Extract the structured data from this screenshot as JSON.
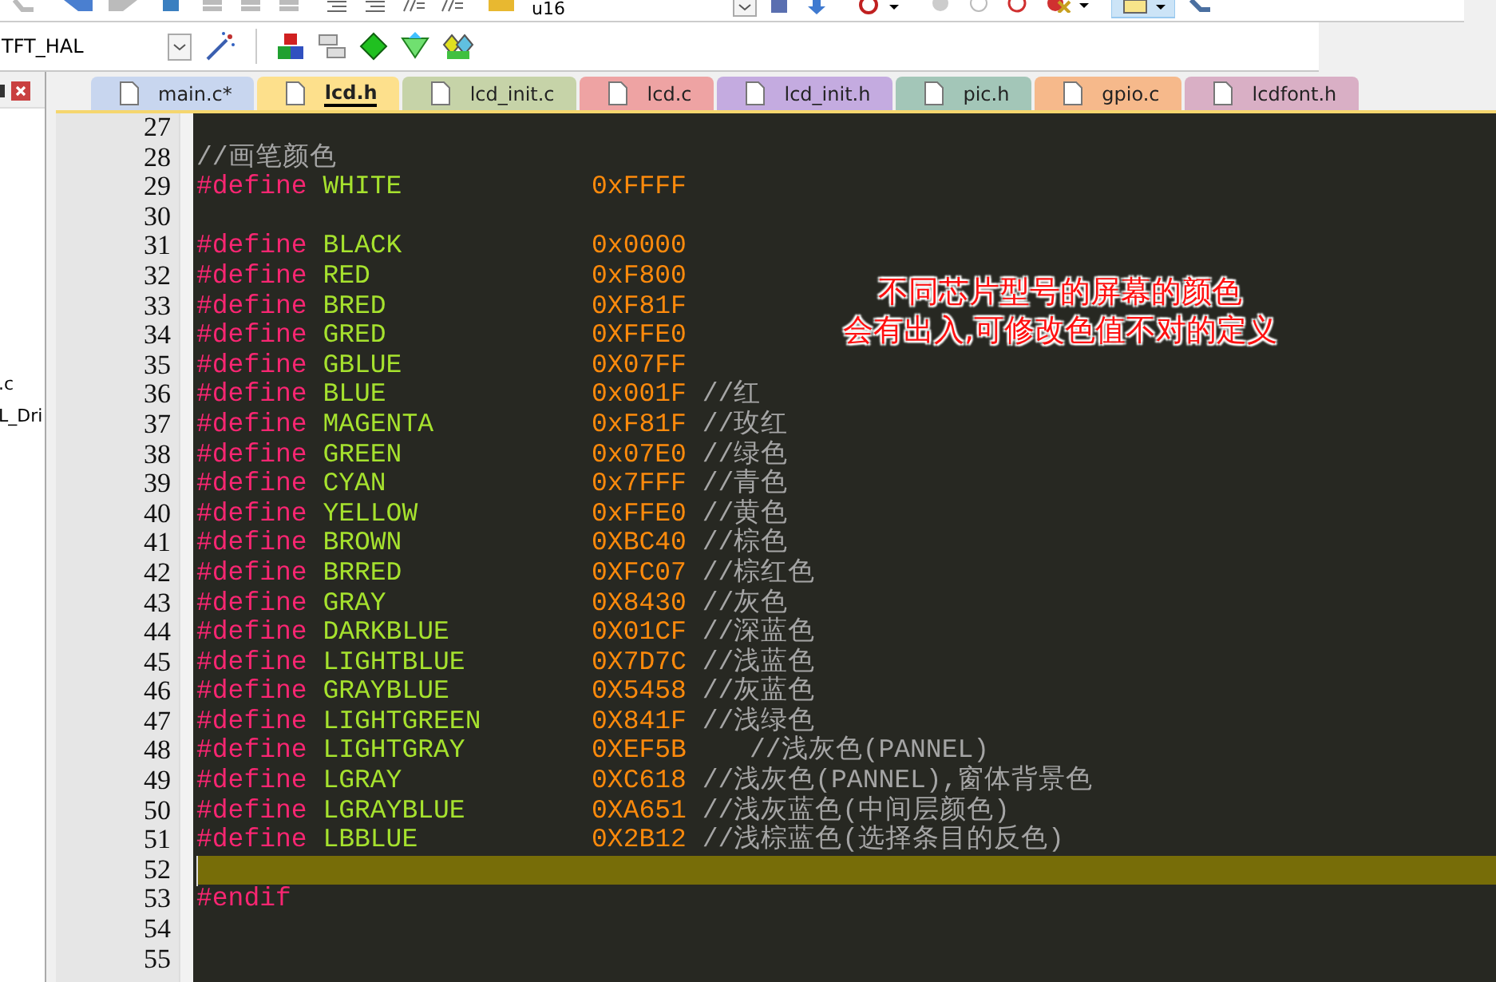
{
  "toolbar_top": {
    "target": "u16"
  },
  "toolbar": {
    "project": "TFT_HAL"
  },
  "project_panel": {
    "items": [
      ".c",
      "L_Dri"
    ]
  },
  "tabs": [
    {
      "label": "main.c*",
      "color": "#c8d6ef",
      "selected": false
    },
    {
      "label": "lcd.h",
      "color": "#fde08c",
      "selected": true
    },
    {
      "label": "lcd_init.c",
      "color": "#c6d3a8",
      "selected": false
    },
    {
      "label": "lcd.c",
      "color": "#eea3a3",
      "selected": false
    },
    {
      "label": "lcd_init.h",
      "color": "#c4abe0",
      "selected": false
    },
    {
      "label": "pic.h",
      "color": "#a3c6b8",
      "selected": false
    },
    {
      "label": "gpio.c",
      "color": "#f6b98b",
      "selected": false
    },
    {
      "label": "lcdfont.h",
      "color": "#d9afc5",
      "selected": false
    }
  ],
  "lines": [
    {
      "number": "27",
      "kind": "blank",
      "current": false
    },
    {
      "number": "28",
      "kind": "comment",
      "text": "//画笔颜色",
      "current": false
    },
    {
      "number": "29",
      "kind": "define",
      "keyword": "#define",
      "name": "WHITE",
      "value": "0xFFFF",
      "current": false
    },
    {
      "number": "30",
      "kind": "blank",
      "current": false
    },
    {
      "number": "31",
      "kind": "define",
      "keyword": "#define",
      "name": "BLACK",
      "value": "0x0000",
      "current": false
    },
    {
      "number": "32",
      "kind": "define",
      "keyword": "#define",
      "name": "RED",
      "value": "0xF800",
      "current": false
    },
    {
      "number": "33",
      "kind": "define",
      "keyword": "#define",
      "name": "BRED",
      "value": "0XF81F",
      "current": false
    },
    {
      "number": "34",
      "kind": "define",
      "keyword": "#define",
      "name": "GRED",
      "value": "0XFFE0",
      "current": false
    },
    {
      "number": "35",
      "kind": "define",
      "keyword": "#define",
      "name": "GBLUE",
      "value": "0X07FF",
      "current": false
    },
    {
      "number": "36",
      "kind": "define",
      "keyword": "#define",
      "name": "BLUE",
      "value": "0x001F",
      "comment": "//红",
      "current": false
    },
    {
      "number": "37",
      "kind": "define",
      "keyword": "#define",
      "name": "MAGENTA",
      "value": "0xF81F",
      "comment": "//玫红",
      "current": false
    },
    {
      "number": "38",
      "kind": "define",
      "keyword": "#define",
      "name": "GREEN",
      "value": "0x07E0",
      "comment": "//绿色",
      "current": false
    },
    {
      "number": "39",
      "kind": "define",
      "keyword": "#define",
      "name": "CYAN",
      "value": "0x7FFF",
      "comment": "//青色",
      "current": false
    },
    {
      "number": "40",
      "kind": "define",
      "keyword": "#define",
      "name": "YELLOW",
      "value": "0xFFE0",
      "comment": "//黄色",
      "current": false
    },
    {
      "number": "41",
      "kind": "define",
      "keyword": "#define",
      "name": "BROWN",
      "value": "0XBC40",
      "comment": "//棕色",
      "current": false
    },
    {
      "number": "42",
      "kind": "define",
      "keyword": "#define",
      "name": "BRRED",
      "value": "0XFC07",
      "comment": "//棕红色",
      "current": false
    },
    {
      "number": "43",
      "kind": "define",
      "keyword": "#define",
      "name": "GRAY",
      "value": "0X8430",
      "comment": "//灰色",
      "current": false
    },
    {
      "number": "44",
      "kind": "define",
      "keyword": "#define",
      "name": "DARKBLUE",
      "value": "0X01CF",
      "comment": "//深蓝色",
      "current": false
    },
    {
      "number": "45",
      "kind": "define",
      "keyword": "#define",
      "name": "LIGHTBLUE",
      "value": "0X7D7C",
      "comment": "//浅蓝色",
      "current": false
    },
    {
      "number": "46",
      "kind": "define",
      "keyword": "#define",
      "name": "GRAYBLUE",
      "value": "0X5458",
      "comment": "//灰蓝色",
      "current": false
    },
    {
      "number": "47",
      "kind": "define",
      "keyword": "#define",
      "name": "LIGHTGREEN",
      "value": "0X841F",
      "comment": "//浅绿色",
      "current": false
    },
    {
      "number": "48",
      "kind": "define",
      "keyword": "#define",
      "name": "LIGHTGRAY",
      "value": "0XEF5B",
      "comment": "   //浅灰色(PANNEL)",
      "current": false
    },
    {
      "number": "49",
      "kind": "define",
      "keyword": "#define",
      "name": "LGRAY",
      "value": "0XC618",
      "comment": "//浅灰色(PANNEL),窗体背景色",
      "current": false
    },
    {
      "number": "50",
      "kind": "define",
      "keyword": "#define",
      "name": "LGRAYBLUE",
      "value": "0XA651",
      "comment": "//浅灰蓝色(中间层颜色)",
      "current": false
    },
    {
      "number": "51",
      "kind": "define",
      "keyword": "#define",
      "name": "LBBLUE",
      "value": "0X2B12",
      "comment": "//浅棕蓝色(选择条目的反色)",
      "current": false
    },
    {
      "number": "52",
      "kind": "blank",
      "current": true
    },
    {
      "number": "53",
      "kind": "directive",
      "text": "#endif",
      "current": false
    },
    {
      "number": "54",
      "kind": "blank",
      "current": false
    },
    {
      "number": "55",
      "kind": "blank",
      "current": false
    }
  ],
  "annotation": {
    "lines": [
      "不同芯片型号的屏幕的颜色",
      "会有出入,可修改色值不对的定义"
    ]
  }
}
